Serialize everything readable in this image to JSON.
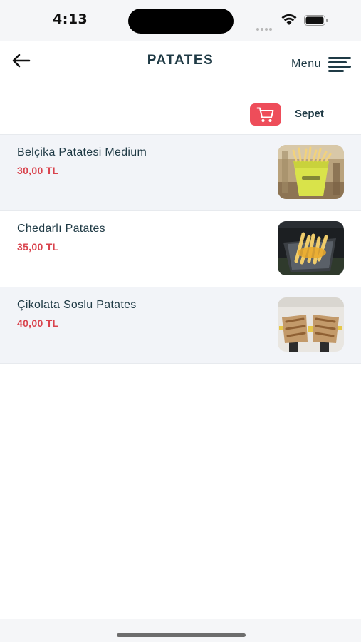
{
  "status_bar": {
    "time": "4:13"
  },
  "header": {
    "title": "PATATES",
    "back_icon": "arrow-left-icon",
    "menu_label": "Menu",
    "menu_icon": "hamburger-icon"
  },
  "cart": {
    "label": "Sepet",
    "icon": "shopping-cart-icon",
    "button_color": "#ee4d5a"
  },
  "products": [
    {
      "name": "Belçika Patatesi Medium",
      "price": "30,00 TL"
    },
    {
      "name": "Chedarlı Patates",
      "price": "35,00 TL"
    },
    {
      "name": "Çikolata Soslu Patates",
      "price": "40,00 TL"
    }
  ],
  "colors": {
    "text_primary": "#1f3a45",
    "price": "#d9434d",
    "row_alt_bg": "#f2f4f8"
  }
}
